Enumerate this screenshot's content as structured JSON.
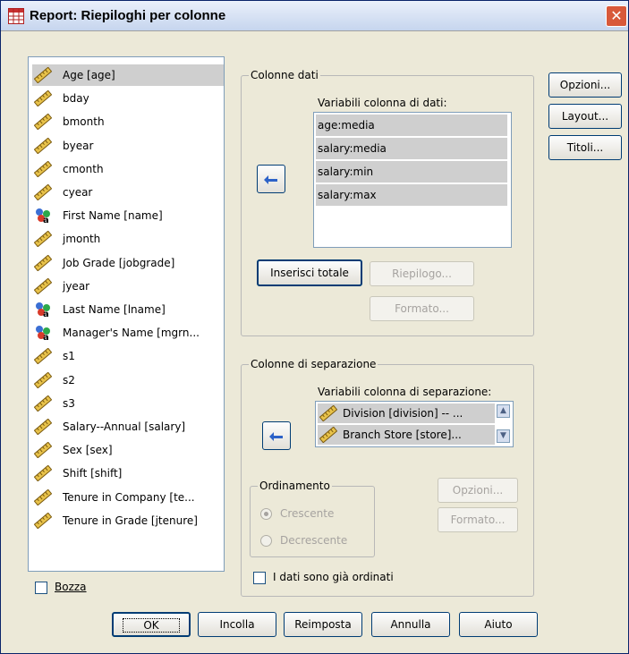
{
  "window": {
    "title": "Report: Riepiloghi per colonne",
    "close_icon": "close-icon"
  },
  "variables": [
    {
      "label": "Age [age]",
      "icon": "scale-icon",
      "selected": true
    },
    {
      "label": "bday",
      "icon": "scale-icon"
    },
    {
      "label": "bmonth",
      "icon": "scale-icon"
    },
    {
      "label": "byear",
      "icon": "scale-icon"
    },
    {
      "label": "cmonth",
      "icon": "scale-icon"
    },
    {
      "label": "cyear",
      "icon": "scale-icon"
    },
    {
      "label": "First Name [name]",
      "icon": "nominal-string-icon"
    },
    {
      "label": "jmonth",
      "icon": "scale-icon"
    },
    {
      "label": "Job Grade [jobgrade]",
      "icon": "scale-icon"
    },
    {
      "label": "jyear",
      "icon": "scale-icon"
    },
    {
      "label": "Last Name [lname]",
      "icon": "nominal-string-icon"
    },
    {
      "label": "Manager's Name [mgrn...",
      "icon": "nominal-string-icon"
    },
    {
      "label": "s1",
      "icon": "scale-icon"
    },
    {
      "label": "s2",
      "icon": "scale-icon"
    },
    {
      "label": "s3",
      "icon": "scale-icon"
    },
    {
      "label": "Salary--Annual [salary]",
      "icon": "scale-icon"
    },
    {
      "label": "Sex [sex]",
      "icon": "scale-icon"
    },
    {
      "label": "Shift [shift]",
      "icon": "scale-icon"
    },
    {
      "label": "Tenure in Company [te...",
      "icon": "scale-icon"
    },
    {
      "label": "Tenure in Grade [jtenure]",
      "icon": "scale-icon"
    }
  ],
  "bozza": {
    "label": "Bozza",
    "checked": false
  },
  "colonne_dati": {
    "group_title": "Colonne dati",
    "list_title": "Variabili colonna di dati:",
    "items": [
      "age:media",
      "salary:media",
      "salary:min",
      "salary:max"
    ],
    "insert_total": "Inserisci totale",
    "riepilogo": "Riepilogo...",
    "formato": "Formato..."
  },
  "colonne_separazione": {
    "group_title": "Colonne di separazione",
    "list_title": "Variabili colonna di separazione:",
    "items": [
      "Division [division] -- ...",
      "Branch Store [store]..."
    ],
    "ordinamento_title": "Ordinamento",
    "crescente": "Crescente",
    "decrescente": "Decrescente",
    "opzioni": "Opzioni...",
    "formato": "Formato...",
    "gia_ordinati": "I dati sono già ordinati"
  },
  "side_buttons": {
    "opzioni": "Opzioni...",
    "layout": "Layout...",
    "titoli": "Titoli..."
  },
  "bottom_buttons": {
    "ok": "OK",
    "incolla": "Incolla",
    "reimposta": "Reimposta",
    "annulla": "Annulla",
    "aiuto": "Aiuto"
  },
  "colors": {
    "titlebar": "#c6d5ee",
    "dialog_bg": "#ece9d8",
    "selection": "#cfcfcf",
    "button_border": "#003c74",
    "arrow_blue": "#2c62c8"
  }
}
